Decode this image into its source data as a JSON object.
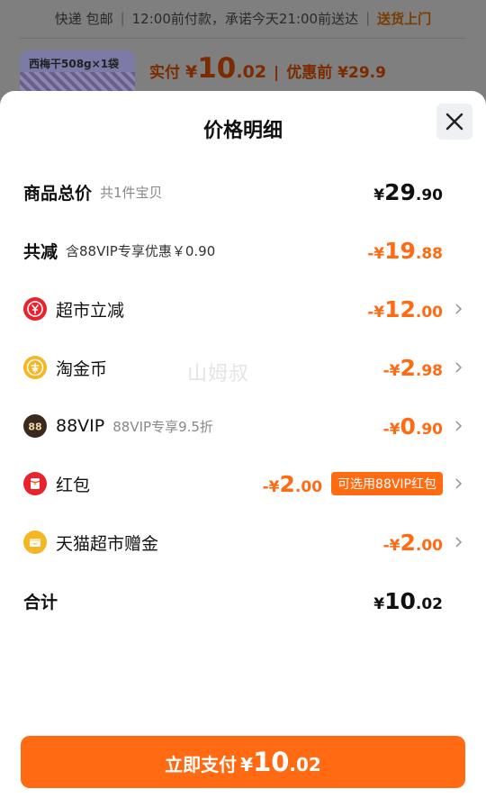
{
  "background": {
    "shipping": {
      "method": "快递 包邮",
      "note": "12:00前付款，承诺今天21:00前送达",
      "deliver": "送货上门"
    },
    "product_label": "西梅干508g×1袋",
    "price_prefix": "实付",
    "price_yen": "¥",
    "price_int": "10",
    "price_dec": ".02",
    "pre_discount": "优惠前 ¥29.9"
  },
  "sheet": {
    "title": "价格明细",
    "close_icon": "close-icon",
    "watermark": "山姆叔",
    "rows": {
      "total": {
        "label": "商品总价",
        "sub": "共1件宝贝",
        "yen": "¥",
        "int": "29",
        "dec": ".90"
      },
      "reduce": {
        "label": "共减",
        "sub": "含88VIP专享优惠￥0.90",
        "yen": "-¥",
        "int": "19",
        "dec": ".88"
      },
      "supermarket": {
        "label": "超市立减",
        "icon": "yen-coupon-icon",
        "yen": "-¥",
        "int": "12",
        "dec": ".00"
      },
      "taojinbi": {
        "label": "淘金币",
        "icon": "gold-coin-icon",
        "yen": "-¥",
        "int": "2",
        "dec": ".98"
      },
      "vip": {
        "label": "88VIP",
        "sub": "88VIP专享9.5折",
        "icon": "vip-88-icon",
        "yen": "-¥",
        "int": "0",
        "dec": ".90"
      },
      "hongbao": {
        "label": "红包",
        "icon": "red-packet-icon",
        "yen": "-¥",
        "int": "2",
        "dec": ".00",
        "tag": "可选用88VIP红包"
      },
      "tmall_gift": {
        "label": "天猫超市赠金",
        "icon": "gift-box-icon",
        "yen": "-¥",
        "int": "2",
        "dec": ".00"
      },
      "sum": {
        "label": "合计",
        "yen": "¥",
        "int": "10",
        "dec": ".02"
      }
    },
    "pay": {
      "label": "立即支付",
      "yen": "¥",
      "int": "10",
      "dec": ".02"
    }
  },
  "colors": {
    "accent": "#ff6a12",
    "red": "#e8232c",
    "gold": "#f5b623",
    "vip_dark": "#3a2a1e"
  }
}
